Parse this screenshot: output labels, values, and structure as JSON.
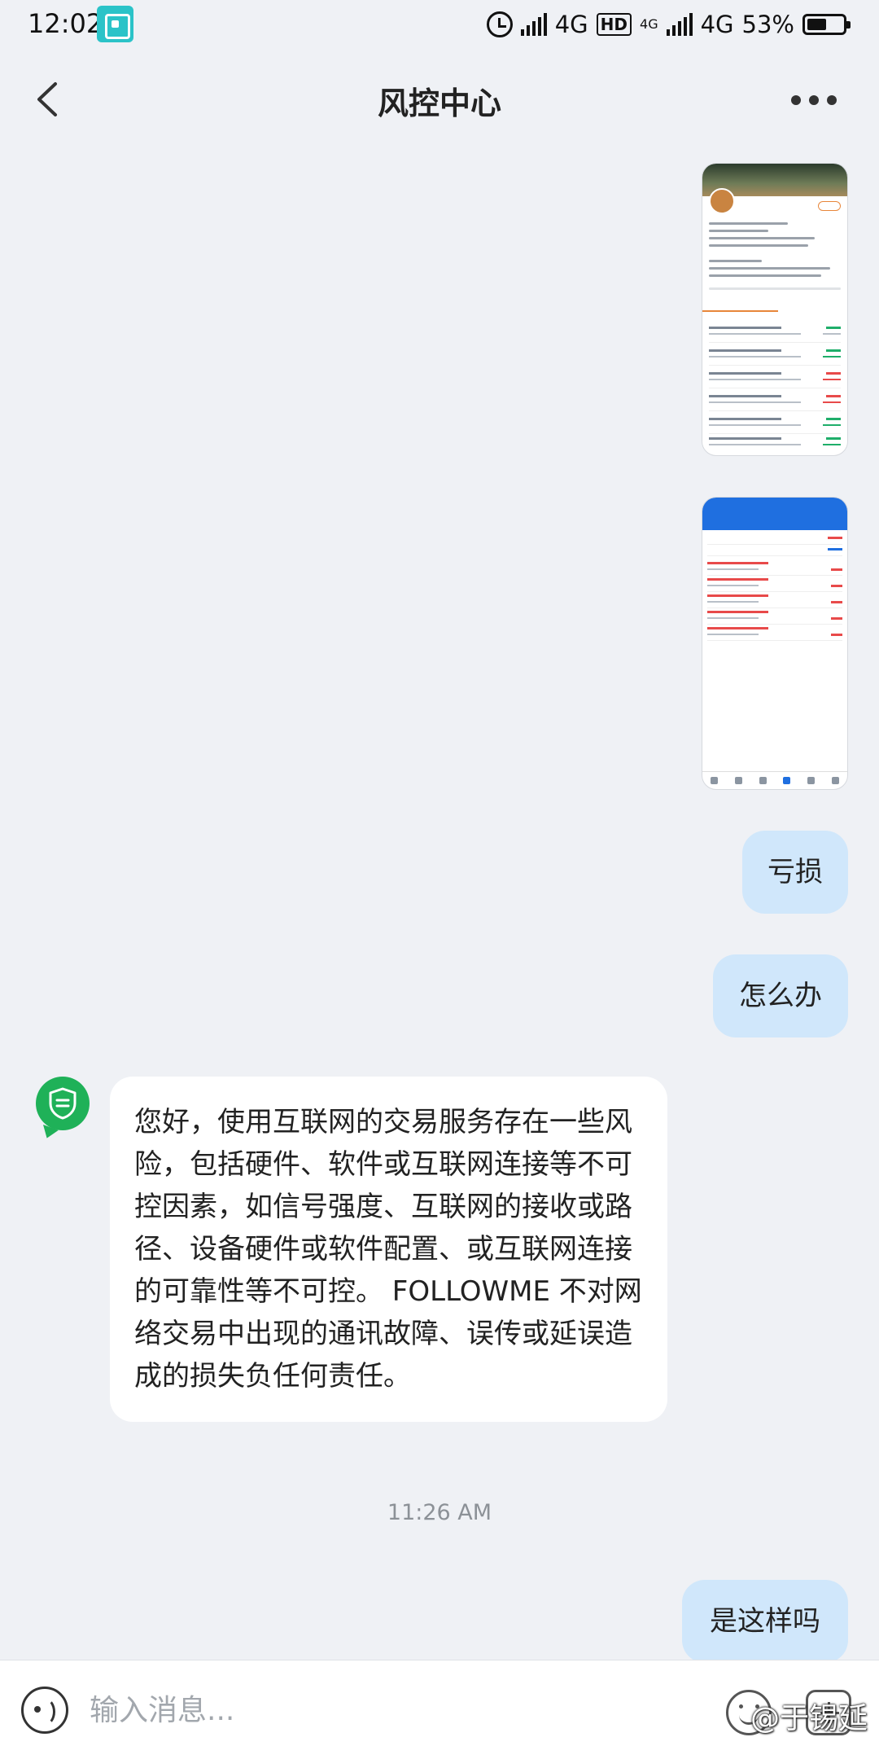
{
  "status_bar": {
    "time": "12:02",
    "network_1": "4G",
    "hd": "HD",
    "network_2_small": "4G",
    "network_2": "4G",
    "battery": "53%"
  },
  "header": {
    "title": "风控中心"
  },
  "messages": {
    "outgoing_1": "亏损",
    "outgoing_2": "怎么办",
    "incoming_1": "您好，使用互联网的交易服务存在一些风险，包括硬件、软件或互联网连接等不可控因素，如信号强度、互联网的接收或路径、设备硬件或软件配置、或互联网连接的可靠性等不可控。 FOLLOWME 不对网络交易中出现的通讯故障、误传或延误造成的损失负任何责任。",
    "timestamp": "11:26 AM",
    "outgoing_3": "是这样吗"
  },
  "input": {
    "placeholder": "输入消息..."
  },
  "watermark": "@于锡延",
  "colors": {
    "bubble_out": "#d0e7fb",
    "bot_avatar": "#1fb158",
    "background": "#eff1f5"
  }
}
